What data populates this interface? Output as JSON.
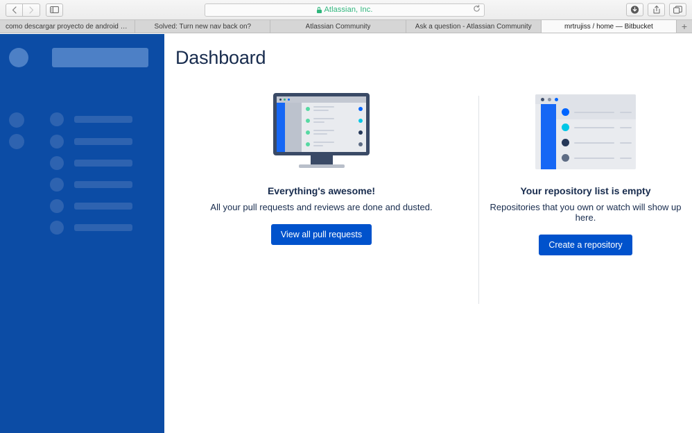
{
  "browser": {
    "nav": {
      "back_label": "Back",
      "forward_label": "Forward",
      "sidebar_label": "Show sidebar"
    },
    "address": {
      "display_text": "Atlassian, Inc.",
      "secure": true,
      "reload_label": "Reload"
    },
    "toolbar_right": [
      {
        "name": "downloads-button",
        "label": "Downloads"
      },
      {
        "name": "share-button",
        "label": "Share"
      },
      {
        "name": "tab-overview-button",
        "label": "Tab Overview"
      }
    ],
    "tabs": [
      {
        "label": "como descargar proyecto de android bit...",
        "active": false
      },
      {
        "label": "Solved: Turn new nav back on?",
        "active": false
      },
      {
        "label": "Atlassian Community",
        "active": false
      },
      {
        "label": "Ask a question - Atlassian Community",
        "active": false
      },
      {
        "label": "mrtrujiss / home — Bitbucket",
        "active": true
      }
    ],
    "new_tab_label": "+"
  },
  "page": {
    "title": "Dashboard",
    "accent_color": "#0052CC",
    "sidebar_color": "#0C4CA5",
    "panels": [
      {
        "illustration": "monitor-illustration",
        "title": "Everything's awesome!",
        "subtitle": "All your pull requests and reviews are done and dusted.",
        "button": "View all pull requests"
      },
      {
        "illustration": "repository-window-illustration",
        "title": "Your repository list is empty",
        "subtitle": "Repositories that you own or watch will show up here.",
        "button": "Create a repository"
      }
    ]
  }
}
